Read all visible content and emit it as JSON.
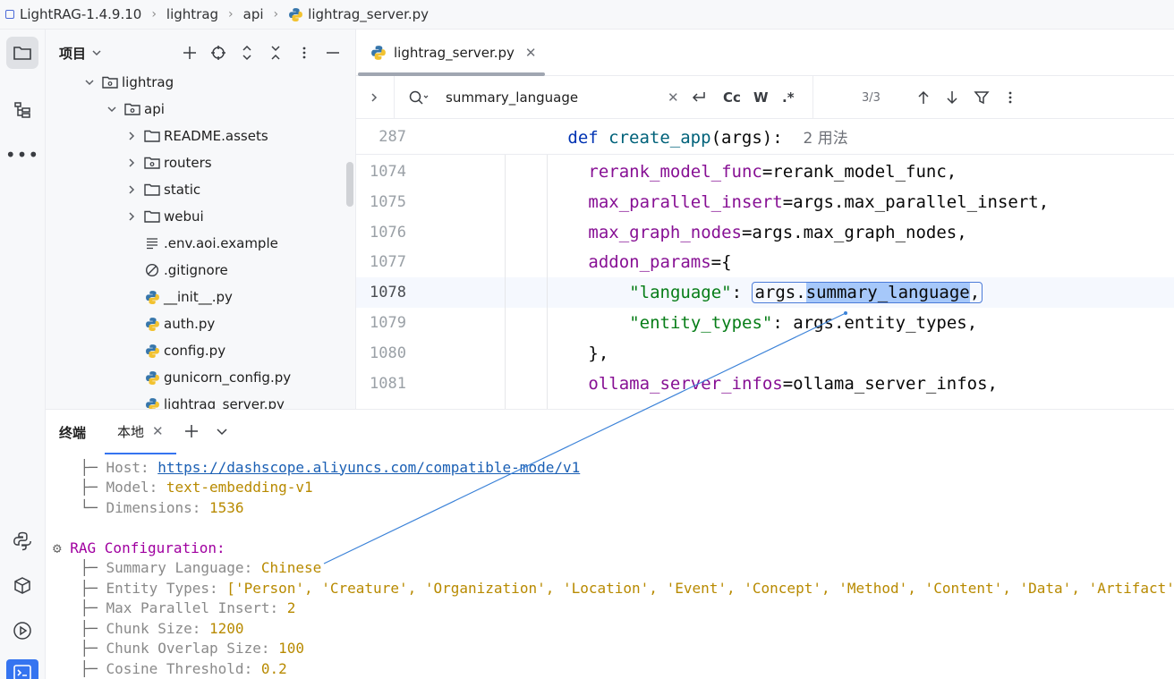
{
  "breadcrumb": {
    "items": [
      "LightRAG-1.4.9.10",
      "lightrag",
      "api",
      "lightrag_server.py"
    ]
  },
  "project_panel": {
    "title": "项目",
    "tree": [
      {
        "label": "lightrag",
        "kind": "package",
        "depth": 0,
        "expanded": true
      },
      {
        "label": "api",
        "kind": "package",
        "depth": 1,
        "expanded": true
      },
      {
        "label": "README.assets",
        "kind": "folder",
        "depth": 2,
        "expanded": false
      },
      {
        "label": "routers",
        "kind": "package",
        "depth": 2,
        "expanded": false
      },
      {
        "label": "static",
        "kind": "folder",
        "depth": 2,
        "expanded": false
      },
      {
        "label": "webui",
        "kind": "folder",
        "depth": 2,
        "expanded": false
      },
      {
        "label": ".env.aoi.example",
        "kind": "text",
        "depth": 2
      },
      {
        "label": ".gitignore",
        "kind": "ignore",
        "depth": 2
      },
      {
        "label": "__init__.py",
        "kind": "python",
        "depth": 2
      },
      {
        "label": "auth.py",
        "kind": "python",
        "depth": 2
      },
      {
        "label": "config.py",
        "kind": "python",
        "depth": 2
      },
      {
        "label": "gunicorn_config.py",
        "kind": "python",
        "depth": 2
      },
      {
        "label": "lightrag_server.py",
        "kind": "python",
        "depth": 2
      }
    ]
  },
  "editor": {
    "tab_label": "lightrag_server.py",
    "find": {
      "query": "summary_language",
      "count": "3/3",
      "case_label": "Cc",
      "word_label": "W",
      "regex_label": ".*"
    },
    "sticky": {
      "line_no": "287",
      "kw": "def",
      "name": "create_app",
      "args": "(args):",
      "usages": "2 用法"
    },
    "lines": [
      {
        "no": "1074",
        "indent": 12,
        "param": "rerank_model_func",
        "rest": "=rerank_model_func,"
      },
      {
        "no": "1075",
        "indent": 12,
        "param": "max_parallel_insert",
        "rest": "=args.max_parallel_insert,"
      },
      {
        "no": "1076",
        "indent": 12,
        "param": "max_graph_nodes",
        "rest": "=args.max_graph_nodes,"
      },
      {
        "no": "1077",
        "indent": 12,
        "param": "addon_params",
        "rest": "={"
      },
      {
        "no": "1078",
        "indent": 16,
        "str": "\"language\"",
        "colon": ": ",
        "pre": "args.",
        "match": "summary_language",
        "post": ","
      },
      {
        "no": "1079",
        "indent": 16,
        "str": "\"entity_types\"",
        "colon": ": ",
        "pre": "args.entity_types,"
      },
      {
        "no": "1080",
        "indent": 12,
        "plain": "},"
      },
      {
        "no": "1081",
        "indent": 12,
        "param": "ollama_server_infos",
        "rest": "=ollama_server_infos,"
      }
    ]
  },
  "terminal": {
    "title": "终端",
    "tab_label": "本地",
    "lines": [
      {
        "tree": "    ├─ ",
        "key": "Host: ",
        "link": "https://dashscope.aliyuncs.com/compatible-mode/v1"
      },
      {
        "tree": "    ├─ ",
        "key": "Model: ",
        "value": "text-embedding-v1"
      },
      {
        "tree": "    └─ ",
        "key": "Dimensions: ",
        "value": "1536"
      },
      {
        "tree": "",
        "key": "",
        "value": ""
      },
      {
        "tree": "⚙ ",
        "section": "RAG Configuration:"
      },
      {
        "tree": "    ├─ ",
        "key": "Summary Language: ",
        "value": "Chinese"
      },
      {
        "tree": "    ├─ ",
        "key": "Entity Types: ",
        "value": "['Person', 'Creature', 'Organization', 'Location', 'Event', 'Concept', 'Method', 'Content', 'Data', 'Artifact', 'NaturalObject']"
      },
      {
        "tree": "    ├─ ",
        "key": "Max Parallel Insert: ",
        "value": "2"
      },
      {
        "tree": "    ├─ ",
        "key": "Chunk Size: ",
        "value": "1200"
      },
      {
        "tree": "    ├─ ",
        "key": "Chunk Overlap Size: ",
        "value": "100"
      },
      {
        "tree": "    ├─ ",
        "key": "Cosine Threshold: ",
        "value": "0.2"
      }
    ]
  },
  "colors": {
    "accent": "#3574f0",
    "keyword": "#0033b3",
    "param": "#871094",
    "string": "#067d17",
    "term_value": "#b88a00",
    "term_section": "#a000a0"
  }
}
